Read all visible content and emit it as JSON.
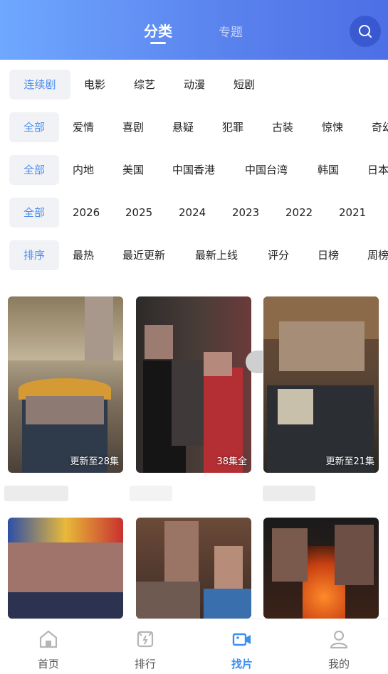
{
  "header": {
    "tabs": [
      {
        "label": "分类",
        "active": true
      },
      {
        "label": "专题",
        "active": false
      }
    ],
    "search_icon": "search-icon"
  },
  "filters": [
    {
      "chip": "连续剧",
      "options": [
        "电影",
        "综艺",
        "动漫",
        "短剧"
      ]
    },
    {
      "chip": "全部",
      "options": [
        "爱情",
        "喜剧",
        "悬疑",
        "犯罪",
        "古装",
        "惊悚",
        "奇幻"
      ]
    },
    {
      "chip": "全部",
      "options": [
        "内地",
        "美国",
        "中国香港",
        "中国台湾",
        "韩国",
        "日本"
      ]
    },
    {
      "chip": "全部",
      "options": [
        "2026",
        "2025",
        "2024",
        "2023",
        "2022",
        "2021"
      ]
    },
    {
      "chip": "排序",
      "options": [
        "最热",
        "最近更新",
        "最新上线",
        "评分",
        "日榜",
        "周榜"
      ]
    }
  ],
  "cards": [
    {
      "badge": "更新至28集"
    },
    {
      "badge": "38集全"
    },
    {
      "badge": "更新至21集"
    },
    {
      "badge": ""
    },
    {
      "badge": ""
    },
    {
      "badge": ""
    }
  ],
  "nav": [
    {
      "label": "首页",
      "icon": "home-icon",
      "active": false
    },
    {
      "label": "排行",
      "icon": "ranking-icon",
      "active": false
    },
    {
      "label": "找片",
      "icon": "video-camera-icon",
      "active": true
    },
    {
      "label": "我的",
      "icon": "user-icon",
      "active": false
    }
  ],
  "colors": {
    "header_gradient_start": "#6fa8ff",
    "header_gradient_end": "#4d6fe6",
    "accent": "#3b8ff0",
    "chip_bg": "#f1f2f5"
  }
}
